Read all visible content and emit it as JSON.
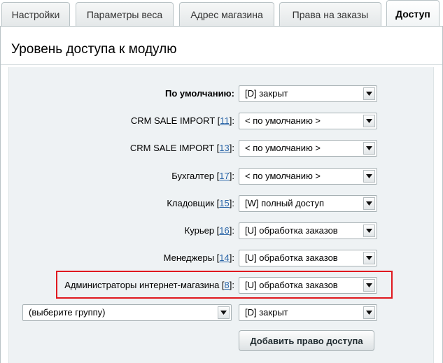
{
  "tabs": [
    {
      "label": "Настройки",
      "active": false
    },
    {
      "label": "Параметры веса",
      "active": false
    },
    {
      "label": "Адрес магазина",
      "active": false
    },
    {
      "label": "Права на заказы",
      "active": false
    },
    {
      "label": "Доступ",
      "active": true
    }
  ],
  "page_title": "Уровень доступа к модулю",
  "rows": [
    {
      "label": "По умолчанию:",
      "link": "",
      "suffix": "",
      "value": "[D] закрыт"
    },
    {
      "label": "CRM SALE IMPORT [",
      "link": "11",
      "suffix": "]:",
      "value": "< по умолчанию >"
    },
    {
      "label": "CRM SALE IMPORT [",
      "link": "13",
      "suffix": "]:",
      "value": "< по умолчанию >"
    },
    {
      "label": "Бухгалтер [",
      "link": "17",
      "suffix": "]:",
      "value": "< по умолчанию >"
    },
    {
      "label": "Кладовщик [",
      "link": "15",
      "suffix": "]:",
      "value": "[W] полный доступ"
    },
    {
      "label": "Курьер [",
      "link": "16",
      "suffix": "]:",
      "value": "[U] обработка заказов"
    },
    {
      "label": "Менеджеры [",
      "link": "14",
      "suffix": "]:",
      "value": "[U] обработка заказов"
    },
    {
      "label": "Администраторы интернет-магазина [",
      "link": "8",
      "suffix": "]:",
      "value": "[U] обработка заказов"
    }
  ],
  "new_row": {
    "group_placeholder": "(выберите группу)",
    "value": "[D] закрыт"
  },
  "add_button_label": "Добавить право доступа",
  "colors": {
    "highlight": "#e0191f",
    "link": "#2b66a8",
    "content_bg": "#eef2f4"
  }
}
